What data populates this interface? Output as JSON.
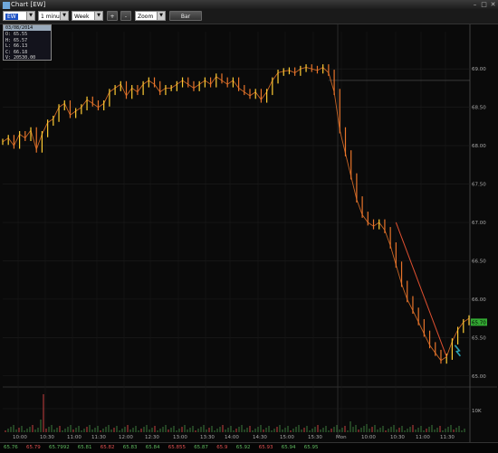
{
  "window": {
    "title": "Chart [EW]"
  },
  "toolbar": {
    "symbol": "EW",
    "interval": "1 minute",
    "range": "Week",
    "plus_label": "+",
    "minus_label": "-",
    "zoom_label": "Zoom",
    "bar_label": "Bar"
  },
  "ohlc_box": {
    "date": "03/08/2014 10:24",
    "open": "O: 65.55",
    "high": "H: 65.57",
    "low": "L: 66.13",
    "close": "C: 66.18",
    "volume": "V: 20530.00"
  },
  "price_axis": {
    "labels": [
      "69.00",
      "68.50",
      "68.00",
      "67.50",
      "67.00",
      "66.50",
      "66.00",
      "65.50",
      "65.00"
    ],
    "current_price": "65.70"
  },
  "volume_axis": {
    "label": "10K"
  },
  "time_axis": {
    "labels": [
      "10:00",
      "10:30",
      "11:00",
      "11:30",
      "12:00",
      "12:30",
      "13:00",
      "13:30",
      "14:00",
      "14:30",
      "15:00",
      "15:30",
      "Mon",
      "10:00",
      "10:30",
      "11:00",
      "11:30"
    ]
  },
  "bottom_prices": [
    {
      "text": "65.76",
      "color": "#5fb85f"
    },
    {
      "text": "65.79",
      "color": "#e05050"
    },
    {
      "text": "65.7992",
      "color": "#5fb85f"
    },
    {
      "text": "65.81",
      "color": "#5fb85f"
    },
    {
      "text": "65.82",
      "color": "#e05050"
    },
    {
      "text": "65.83",
      "color": "#5fb85f"
    },
    {
      "text": "65.84",
      "color": "#5fb85f"
    },
    {
      "text": "65.855",
      "color": "#e05050"
    },
    {
      "text": "65.87",
      "color": "#5fb85f"
    },
    {
      "text": "65.9",
      "color": "#e05050"
    },
    {
      "text": "65.92",
      "color": "#5fb85f"
    },
    {
      "text": "65.93",
      "color": "#e05050"
    },
    {
      "text": "65.94",
      "color": "#5fb85f"
    },
    {
      "text": "65.95",
      "color": "#5fb85f"
    }
  ],
  "colors": {
    "up": "#ffcc33",
    "down": "#e8742a",
    "trend": "#e05030",
    "price_tag": "#33aa33"
  },
  "chart_data": {
    "type": "candlestick-line",
    "yticks": [
      69.0,
      68.5,
      68.0,
      67.5,
      67.0,
      66.5,
      66.0,
      65.5,
      65.0
    ],
    "ylim": [
      64.95,
      69.25
    ],
    "series": [
      {
        "values": [
          68.05,
          68.1,
          68.0,
          68.15,
          68.1,
          68.2,
          67.95,
          68.15,
          68.3,
          68.35,
          68.5,
          68.55,
          68.4,
          68.45,
          68.5,
          68.6,
          68.55,
          68.5,
          68.55,
          68.7,
          68.75,
          68.8,
          68.65,
          68.75,
          68.7,
          68.8,
          68.85,
          68.8,
          68.7,
          68.75,
          68.75,
          68.8,
          68.85,
          68.8,
          68.75,
          68.8,
          68.85,
          68.8,
          68.9,
          68.85,
          68.8,
          68.85,
          68.75,
          68.7,
          68.65,
          68.7,
          68.6,
          68.7,
          68.85,
          68.95,
          68.97,
          68.98,
          68.95,
          69.0,
          69.02,
          69.0,
          68.98,
          69.02,
          68.95,
          68.7,
          68.2,
          67.9,
          67.6,
          67.3,
          67.1,
          67.0,
          66.95,
          67.0,
          66.9,
          66.7,
          66.45,
          66.2,
          66.0,
          65.85,
          65.7,
          65.55,
          65.4,
          65.3,
          65.2,
          65.25,
          65.45,
          65.6,
          65.7,
          65.75
        ]
      }
    ],
    "trendline": [
      [
        67.0,
        70
      ],
      [
        65.25,
        79
      ]
    ],
    "current": 65.7
  }
}
